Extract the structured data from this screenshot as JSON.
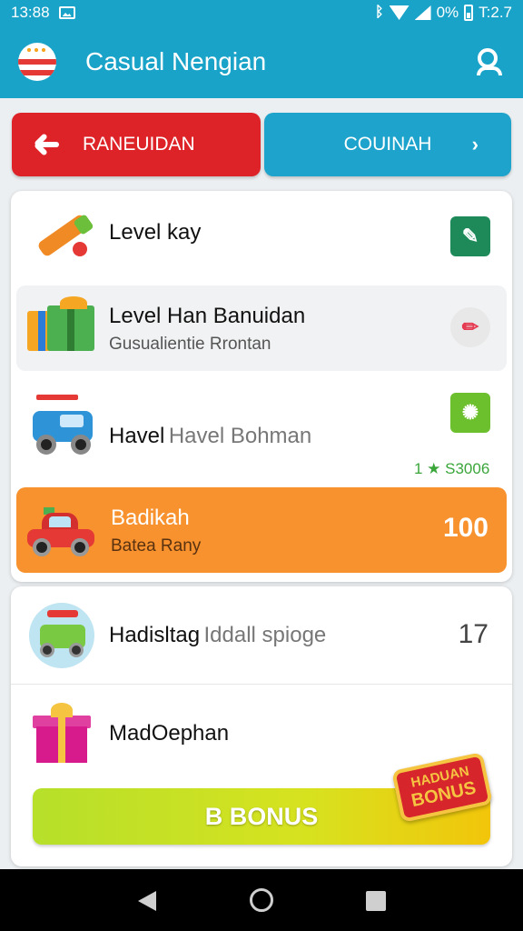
{
  "status_bar": {
    "time": "13:88",
    "battery": "0%",
    "right_time": "T:2.7"
  },
  "app_bar": {
    "title": "Casual Nengian"
  },
  "actions": {
    "left_label": "RANEUIDAN",
    "right_label": "COUINAH"
  },
  "list1": [
    {
      "title": "Level kay"
    },
    {
      "title": "Level Han Banuidan",
      "subtitle": "Gusualientie Rrontan"
    },
    {
      "title_a": "Havel",
      "title_b": "Havel Bohman",
      "rating": "1 ★ S3006"
    },
    {
      "title": "Badikah",
      "subtitle": "Batea Rany",
      "value": "100"
    }
  ],
  "list2": [
    {
      "title_a": "Hadisltag",
      "title_b": "Iddall spioge",
      "value": "17"
    },
    {
      "title": "MadOephan"
    }
  ],
  "bonus": {
    "button_label": "B BONUS",
    "badge_line1": "HADUAN",
    "badge_line2": "BONUS"
  },
  "colors": {
    "primary": "#1aa3c8",
    "red": "#de2328",
    "orange": "#f7922f",
    "green": "#1e8a5a"
  }
}
